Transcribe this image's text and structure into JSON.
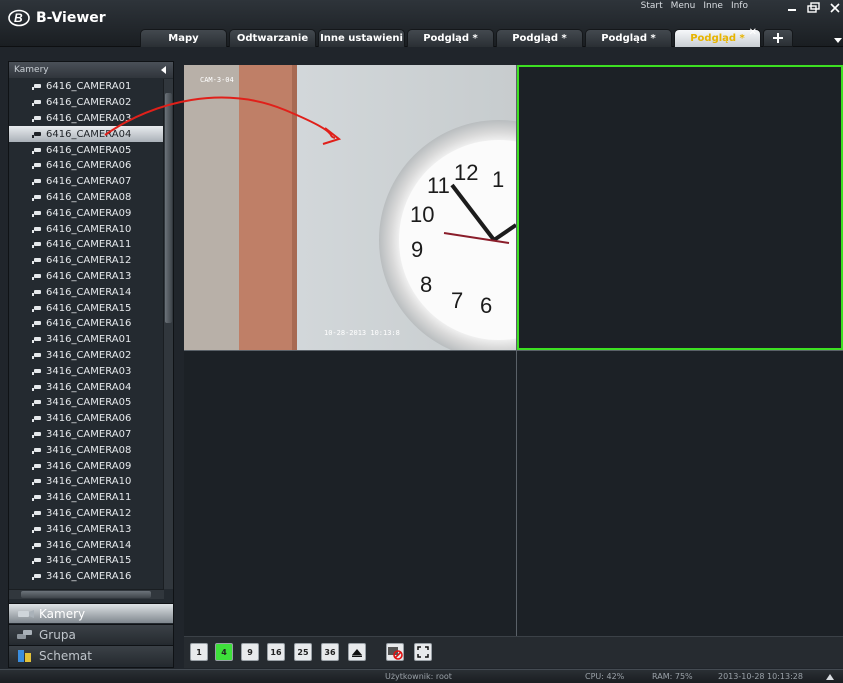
{
  "app": {
    "title": "B-Viewer"
  },
  "top_menu": [
    "Start",
    "Menu",
    "Inne",
    "Info"
  ],
  "tabs": [
    {
      "label": "Mapy"
    },
    {
      "label": "Odtwarzanie"
    },
    {
      "label": "Inne ustawieni"
    },
    {
      "label": "Podgląd *"
    },
    {
      "label": "Podgląd *"
    },
    {
      "label": "Podgląd *"
    },
    {
      "label": "Podgląd *",
      "active": true
    }
  ],
  "sidebar": {
    "header": "Kamery",
    "selected_camera": "6416_CAMERA04",
    "cameras": [
      "6416_CAMERA01",
      "6416_CAMERA02",
      "6416_CAMERA03",
      "6416_CAMERA04",
      "6416_CAMERA05",
      "6416_CAMERA06",
      "6416_CAMERA07",
      "6416_CAMERA08",
      "6416_CAMERA09",
      "6416_CAMERA10",
      "6416_CAMERA11",
      "6416_CAMERA12",
      "6416_CAMERA13",
      "6416_CAMERA14",
      "6416_CAMERA15",
      "6416_CAMERA16",
      "3416_CAMERA01",
      "3416_CAMERA02",
      "3416_CAMERA03",
      "3416_CAMERA04",
      "3416_CAMERA05",
      "3416_CAMERA06",
      "3416_CAMERA07",
      "3416_CAMERA08",
      "3416_CAMERA09",
      "3416_CAMERA10",
      "3416_CAMERA11",
      "3416_CAMERA12",
      "3416_CAMERA13",
      "3416_CAMERA14",
      "3416_CAMERA15",
      "3416_CAMERA16"
    ],
    "nav": [
      {
        "label": "Kamery",
        "active": true
      },
      {
        "label": "Grupa"
      },
      {
        "label": "Schemat"
      }
    ]
  },
  "video": {
    "pane1_osd_name": "CAM-3-04",
    "pane1_osd_time": "10-28-2013 10:13:8",
    "selected_pane_color": "#3de022"
  },
  "layout_buttons": [
    "1",
    "4",
    "9",
    "16",
    "25",
    "36"
  ],
  "active_layout": "4",
  "status": {
    "user": "Użytkownik: root",
    "cpu": "CPU: 42%",
    "ram": "RAM: 75%",
    "datetime": "2013-10-28 10:13:28"
  }
}
